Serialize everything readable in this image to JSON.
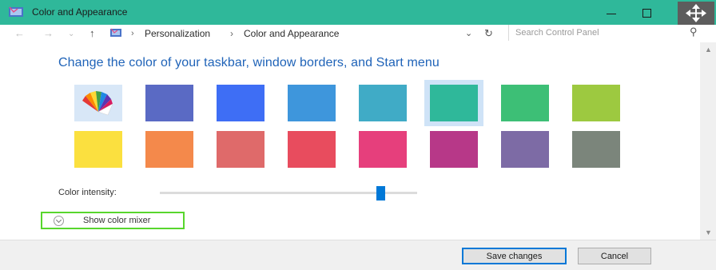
{
  "window": {
    "title": "Color and Appearance",
    "accent": "#2fb89a"
  },
  "nav": {
    "back_icon": "←",
    "forward_icon": "→",
    "recent_icon": "⌄",
    "up_icon": "↑",
    "crumb_separator": "›",
    "breadcrumb": [
      "Personalization",
      "Color and Appearance"
    ],
    "dropdown_icon": "⌄",
    "refresh_icon": "↻",
    "search_placeholder": "Search Control Panel",
    "search_icon": "⚲"
  },
  "main": {
    "title": "Change the color of your taskbar, window borders, and Start menu",
    "swatches": [
      {
        "name": "automatic",
        "color": "#d8e7f7"
      },
      {
        "name": "blue-violet",
        "color": "#5a6ac4"
      },
      {
        "name": "royal-blue",
        "color": "#3e6ef5"
      },
      {
        "name": "sky-blue",
        "color": "#3e96dc"
      },
      {
        "name": "cyan",
        "color": "#40abc6"
      },
      {
        "name": "teal",
        "color": "#2fb89a"
      },
      {
        "name": "green",
        "color": "#3dbf76"
      },
      {
        "name": "lime",
        "color": "#9dc940"
      },
      {
        "name": "yellow",
        "color": "#fbe03f"
      },
      {
        "name": "orange",
        "color": "#f4894b"
      },
      {
        "name": "salmon",
        "color": "#df6a6a"
      },
      {
        "name": "red",
        "color": "#e84c5e"
      },
      {
        "name": "pink",
        "color": "#e63f7c"
      },
      {
        "name": "magenta",
        "color": "#b73888"
      },
      {
        "name": "purple",
        "color": "#7d6ba5"
      },
      {
        "name": "gray-green",
        "color": "#7b857b"
      }
    ],
    "selected_swatch": "teal",
    "intensity_label": "Color intensity:",
    "intensity_value": 0.86,
    "mixer_label": "Show color mixer"
  },
  "footer": {
    "save_label": "Save changes",
    "cancel_label": "Cancel"
  }
}
